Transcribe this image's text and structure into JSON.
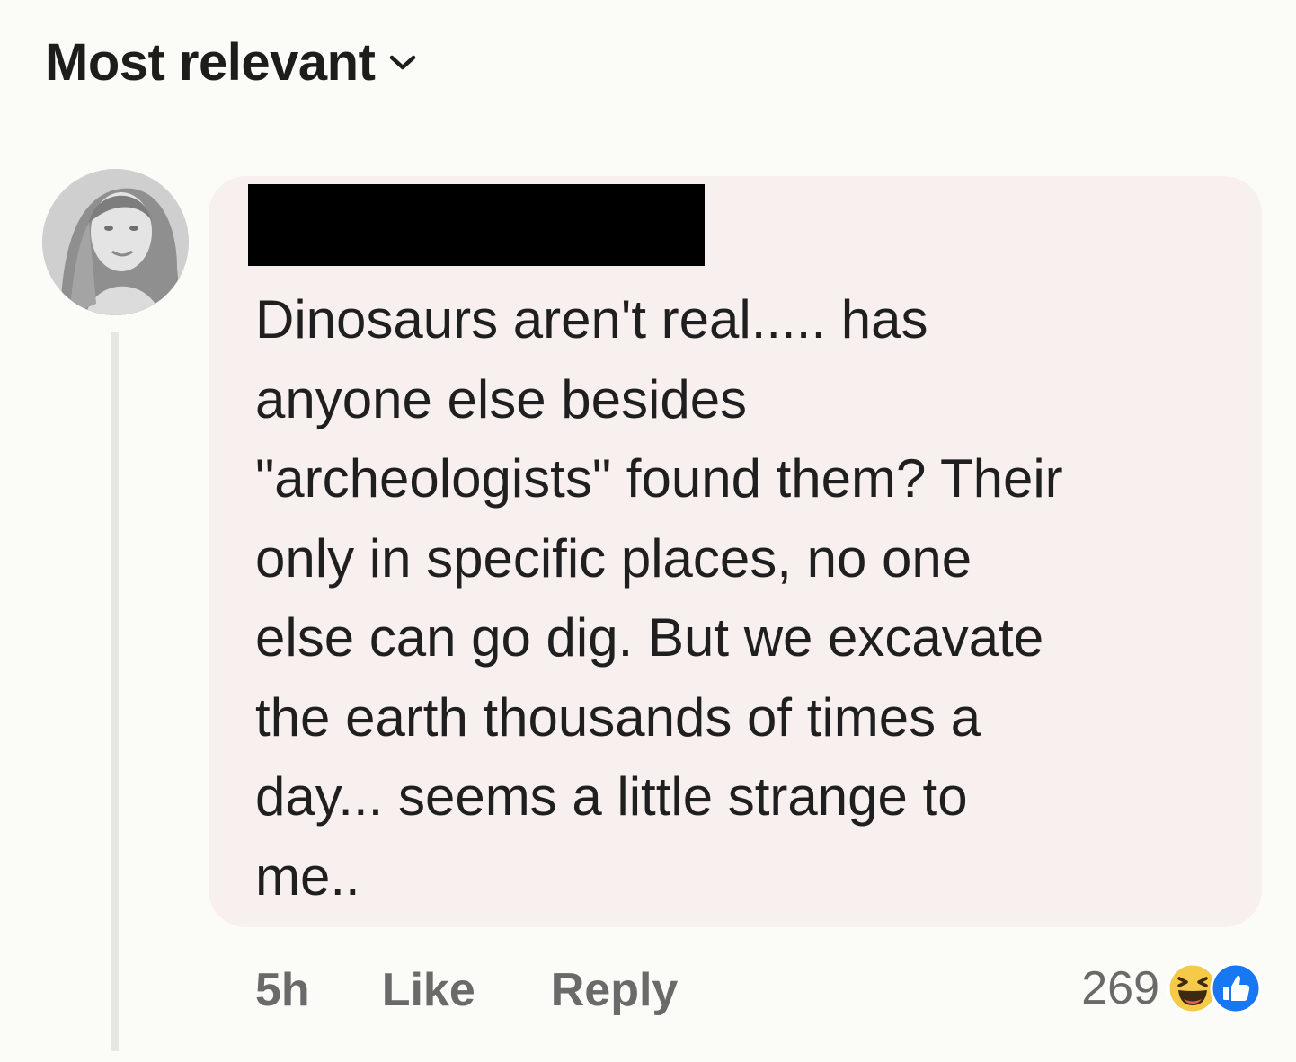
{
  "sort": {
    "label": "Most relevant",
    "icon": "chevron-down-icon"
  },
  "comment": {
    "avatar_icon": "avatar-photo",
    "author_redacted": true,
    "text": "Dinosaurs aren't real..... has\nanyone else besides\n\"archeologists\" found them? Their\nonly in specific places, no one\nelse can go dig. But we excavate\nthe earth thousands of times a\nday... seems a little strange to\nme..",
    "timestamp": "5h",
    "like_label": "Like",
    "reply_label": "Reply",
    "reaction_count": "269",
    "reaction_icons": [
      "haha-icon",
      "like-icon"
    ]
  },
  "colors": {
    "background": "#fbfbf7",
    "bubble": "#f7f0ef",
    "like_blue": "#1877f2",
    "haha_yellow": "#f7c948",
    "muted_text": "#6a6a6a"
  }
}
